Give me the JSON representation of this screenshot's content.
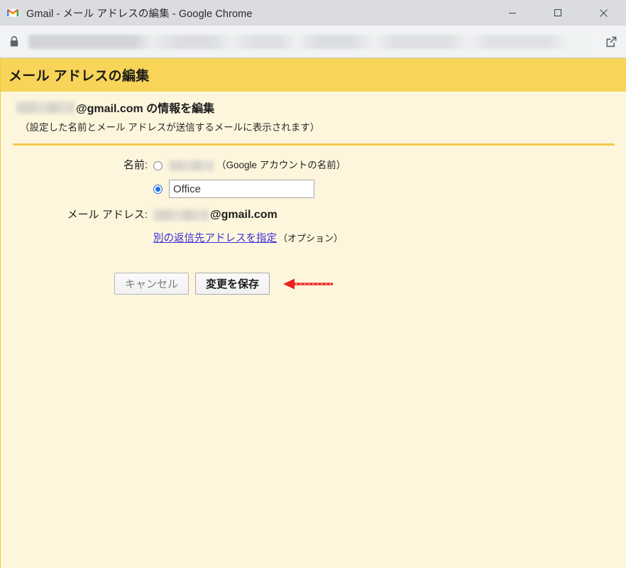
{
  "window": {
    "title": "Gmail - メール アドレスの編集 - Google Chrome",
    "favicon": "gmail-m-icon",
    "controls": {
      "minimize": "minimize-icon",
      "maximize": "maximize-icon",
      "close": "close-icon"
    }
  },
  "addressbar": {
    "lock_icon": "lock-icon",
    "url_value": "",
    "url_redacted": true,
    "popout_icon": "open-in-new-window-icon"
  },
  "page": {
    "header_title": "メール アドレスの編集",
    "intro": {
      "redacted_user": "",
      "domain_text": "@gmail.com の情報を編集",
      "note": "（設定した名前とメール アドレスが送信するメールに表示されます）"
    },
    "form": {
      "name_label": "名前:",
      "account_name_redacted": "",
      "account_name_hint": "（Google アカウントの名前）",
      "custom_name_value": "Office",
      "custom_name_placeholder": "",
      "selected_option": "custom",
      "email_label": "メール アドレス:",
      "email_user_redacted": "",
      "email_domain": "@gmail.com",
      "reply_to_link": "別の返信先アドレスを指定",
      "reply_to_optional": "（オプション）"
    },
    "buttons": {
      "cancel": "キャンセル",
      "save": "変更を保存"
    },
    "annotation": {
      "arrow_color": "#e8231f",
      "arrow_direction": "left",
      "points_to": "save-button"
    }
  },
  "colors": {
    "header_bar": "#f8d458",
    "page_background": "#fdf6dd",
    "divider": "#f3ca4a",
    "link": "#3b2fd4",
    "radio_selected": "#1a73e8",
    "titlebar": "#dadce0",
    "addressbar": "#f1f3f4"
  }
}
